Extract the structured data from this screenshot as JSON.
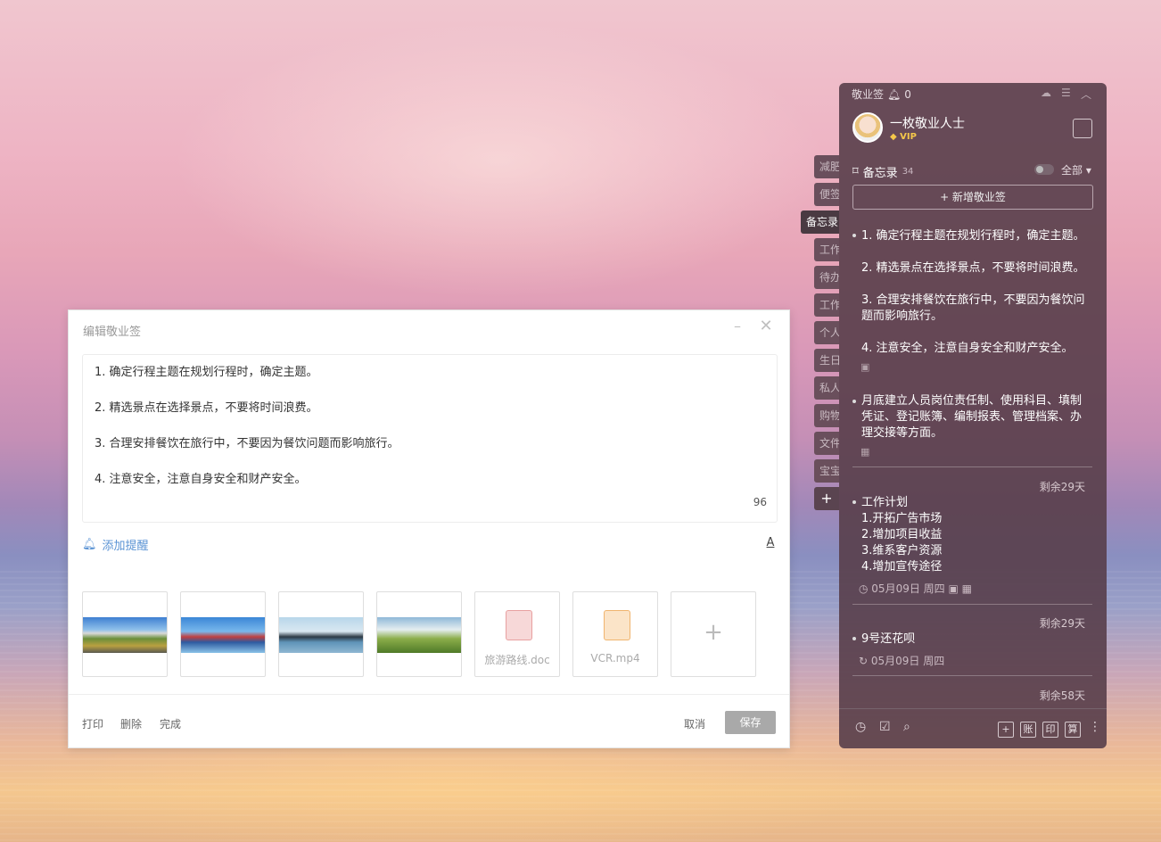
{
  "editor": {
    "title": "编辑敬业签",
    "lines": [
      "1. 确定行程主题在规划行程时，确定主题。",
      "2. 精选景点在选择景点，不要将时间浪费。",
      "3. 合理安排餐饮在旅行中，不要因为餐饮问题而影响旅行。",
      "4. 注意安全，注意自身安全和财产安全。"
    ],
    "char_count": "96",
    "add_reminder": "添加提醒",
    "font_icon": "A",
    "attachments": [
      "旅游路线.doc",
      "VCR.mp4"
    ],
    "footer": {
      "print": "打印",
      "delete": "删除",
      "done": "完成",
      "cancel": "取消",
      "save": "保存"
    }
  },
  "side_tabs": [
    "减肥",
    "便签",
    "备忘录",
    "工作",
    "待办",
    "工作",
    "个人",
    "生日",
    "私人",
    "购物",
    "文件",
    "宝宝"
  ],
  "widget": {
    "app_name": "敬业签",
    "bell_count": "0",
    "user": {
      "name": "一枚敬业人士",
      "badge": "VIP"
    },
    "section": {
      "title": "备忘录",
      "count": "34",
      "filter": "全部"
    },
    "new_button": "+ 新增敬业签",
    "notes": [
      {
        "lines": [
          "1. 确定行程主题在规划行程时，确定主题。",
          "2. 精选景点在选择景点，不要将时间浪费。",
          "3. 合理安排餐饮在旅行中，不要因为餐饮问",
          "题而影响旅行。",
          "4. 注意安全，注意自身安全和财产安全。"
        ]
      },
      {
        "lines": [
          "月底建立人员岗位责任制、使用科目、填制",
          "凭证、登记账簿、编制报表、管理档案、办",
          "理交接等方面。"
        ]
      },
      {
        "remain": "剩余29天",
        "lines": [
          "工作计划",
          "1.开拓广告市场",
          "2.增加项目收益",
          "3.维系客户资源",
          "4.增加宣传途径"
        ],
        "date": "05月09日 周四"
      },
      {
        "remain": "剩余29天",
        "lines": [
          "9号还花呗"
        ],
        "date": "05月09日 周四"
      },
      {
        "remain": "剩余58天"
      }
    ],
    "footer_boxes": [
      "+",
      "账",
      "印",
      "算"
    ]
  }
}
